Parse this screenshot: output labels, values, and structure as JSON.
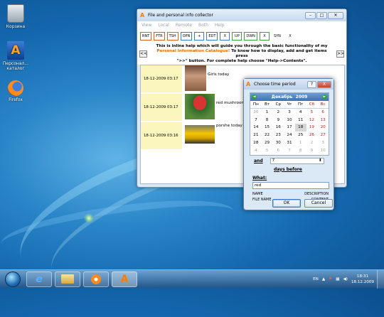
{
  "desktop": {
    "icons": [
      {
        "label": "Корзина"
      },
      {
        "label": "Персонал... каталог"
      },
      {
        "label": "Firefox"
      }
    ]
  },
  "window": {
    "title": "File and personal info collector",
    "menu": [
      "View",
      "Local",
      "Remote",
      "Both",
      "Help"
    ],
    "toolbar": [
      "RNT",
      "FTR",
      "TSH",
      "OPN",
      "+",
      "EDT",
      "X",
      "UP",
      "DWN",
      "X",
      "SYN",
      "X"
    ],
    "help": {
      "nav_prev": "<<",
      "nav_next": ">>",
      "line1": "This is inline help which will guide you through the basic functionality of my",
      "highlight": "Personal Information Catalogue!",
      "line2": " To know how to display, add and get items press",
      "line3": "\">>\" button. For complete help choose \"Help->Contents\"."
    },
    "items": [
      {
        "date": "18-12-2009 03:17",
        "caption": "Girls today"
      },
      {
        "date": "18-12-2009 03:17",
        "caption": "red mushroom"
      },
      {
        "date": "18-12-2009 03:16",
        "caption": "porshe today"
      }
    ]
  },
  "dialog": {
    "title": "Choose time period",
    "help_btn": "?",
    "close_btn": "X",
    "month": "Декабрь",
    "year": "2009",
    "prev": "◄",
    "next": "►",
    "weekdays": [
      "Пн",
      "Вт",
      "Ср",
      "Чт",
      "Пт",
      "Сб",
      "Вс"
    ],
    "days": [
      [
        "30",
        "1",
        "2",
        "3",
        "4",
        "5",
        "6"
      ],
      [
        "7",
        "8",
        "9",
        "10",
        "11",
        "12",
        "13"
      ],
      [
        "14",
        "15",
        "16",
        "17",
        "18",
        "19",
        "20"
      ],
      [
        "21",
        "22",
        "23",
        "24",
        "25",
        "26",
        "27"
      ],
      [
        "28",
        "29",
        "30",
        "31",
        "1",
        "2",
        "3"
      ],
      [
        "4",
        "5",
        "6",
        "7",
        "8",
        "9",
        "10"
      ]
    ],
    "today": "18",
    "and_label": "and",
    "days_value": "7",
    "days_before": "days before",
    "what_label": "What:",
    "what_value": "red",
    "name": "NAME",
    "description": "DESCRIPTION",
    "file_name": "FILE NAME",
    "content": "CONTENT",
    "ok": "OK",
    "cancel": "Cancel"
  },
  "taskbar": {
    "lang": "EN",
    "time": "18:31",
    "date": "18.12.2009"
  }
}
